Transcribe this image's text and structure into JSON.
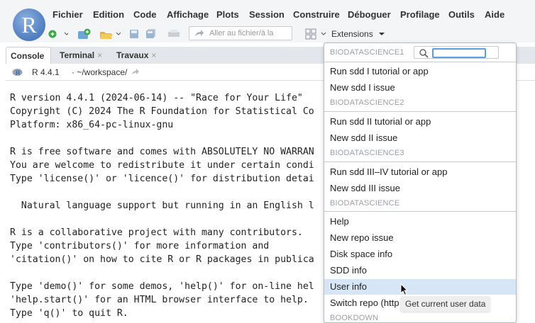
{
  "app": {
    "logo_letter": "R"
  },
  "menubar": {
    "items": [
      "Fichier",
      "Edition",
      "Code",
      "Affichage",
      "Plots",
      "Session",
      "Construire",
      "Déboguer",
      "Profilage",
      "Outils",
      "Aide"
    ]
  },
  "toolbar": {
    "goto_placeholder": "Aller au fichier/à la",
    "extensions_label": "Extensions"
  },
  "tabs": [
    {
      "label": "Console",
      "closable": false
    },
    {
      "label": "Terminal",
      "closable": true
    },
    {
      "label": "Travaux",
      "closable": true
    }
  ],
  "tab_close_glyph": "×",
  "console": {
    "r_version": "R 4.4.1",
    "working_dir": "· ~/workspace/",
    "lines": [
      "R version 4.4.1 (2024-06-14) -- \"Race for Your Life\"",
      "Copyright (C) 2024 The R Foundation for Statistical Co",
      "Platform: x86_64-pc-linux-gnu",
      "",
      "R is free software and comes with ABSOLUTELY NO WARRAN",
      "You are welcome to redistribute it under certain condi",
      "Type 'license()' or 'licence()' for distribution detai",
      "",
      "  Natural language support but running in an English l",
      "",
      "R is a collaborative project with many contributors.",
      "Type 'contributors()' for more information and",
      "'citation()' on how to cite R or R packages in publica",
      "",
      "Type 'demo()' for some demos, 'help()' for on-line hel",
      "'help.start()' for an HTML browser interface to help.",
      "Type 'q()' to quit R."
    ]
  },
  "dropdown": {
    "search_value": "",
    "sections": [
      {
        "header": "BIODATASCIENCE1",
        "items": [
          "Run sdd I tutorial or app",
          "New sdd I issue"
        ]
      },
      {
        "header": "BIODATASCIENCE2",
        "items": [
          "Run sdd II tutorial or app",
          "New sdd II issue"
        ]
      },
      {
        "header": "BIODATASCIENCE3",
        "items": [
          "Run sdd III–IV tutorial or app",
          "New sdd III issue"
        ]
      },
      {
        "header": "BIODATASCIENCE",
        "items": [
          "Help",
          "New repo issue",
          "Disk space info",
          "SDD info",
          "User info",
          "Switch repo (http"
        ]
      },
      {
        "header": "BOOKDOWN",
        "items": []
      }
    ],
    "hovered_item": "User info"
  },
  "tooltip": {
    "text": "Get current user data"
  },
  "colors": {
    "accent": "#5a9ee8",
    "hover": "#d7e6f7",
    "logo": "#5b87c7"
  }
}
